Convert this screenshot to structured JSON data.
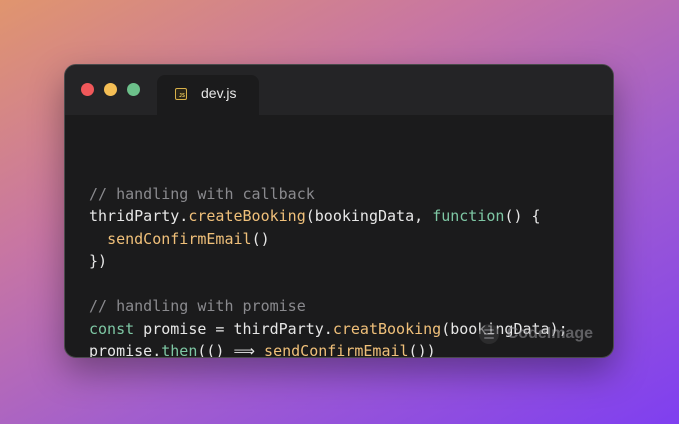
{
  "window": {
    "controls": [
      "close",
      "minimize",
      "maximize"
    ]
  },
  "tab": {
    "icon_text": "JS",
    "label": "dev.js"
  },
  "code": {
    "lines": [
      [],
      [
        {
          "text": "// handling with callback",
          "class": "comment"
        }
      ],
      [
        {
          "text": "thridParty.",
          "class": "plain"
        },
        {
          "text": "createBooking",
          "class": "fn"
        },
        {
          "text": "(bookingData, ",
          "class": "plain"
        },
        {
          "text": "function",
          "class": "kw"
        },
        {
          "text": "() {",
          "class": "plain"
        }
      ],
      [
        {
          "text": "  ",
          "class": "plain"
        },
        {
          "text": "sendConfirmEmail",
          "class": "fn"
        },
        {
          "text": "()",
          "class": "plain"
        }
      ],
      [
        {
          "text": "})",
          "class": "plain"
        }
      ],
      [],
      [
        {
          "text": "// handling with promise",
          "class": "comment"
        }
      ],
      [
        {
          "text": "const",
          "class": "kw"
        },
        {
          "text": " promise = thirdParty.",
          "class": "plain"
        },
        {
          "text": "creatBooking",
          "class": "fn"
        },
        {
          "text": "(bookingData);",
          "class": "plain"
        }
      ],
      [
        {
          "text": "promise.",
          "class": "plain"
        },
        {
          "text": "then",
          "class": "kw"
        },
        {
          "text": "(() ⟹ ",
          "class": "plain"
        },
        {
          "text": "sendConfirmEmail",
          "class": "fn"
        },
        {
          "text": "())",
          "class": "plain"
        }
      ]
    ]
  },
  "watermark": {
    "text": "CodeImage",
    "icon": "codeimage-logo-icon"
  },
  "colors": {
    "comment": "#8a8a8e",
    "function": "#f0c07a",
    "keyword": "#7ec7a4",
    "plain": "#e7e7e7",
    "window_bg": "#1b1b1c"
  }
}
